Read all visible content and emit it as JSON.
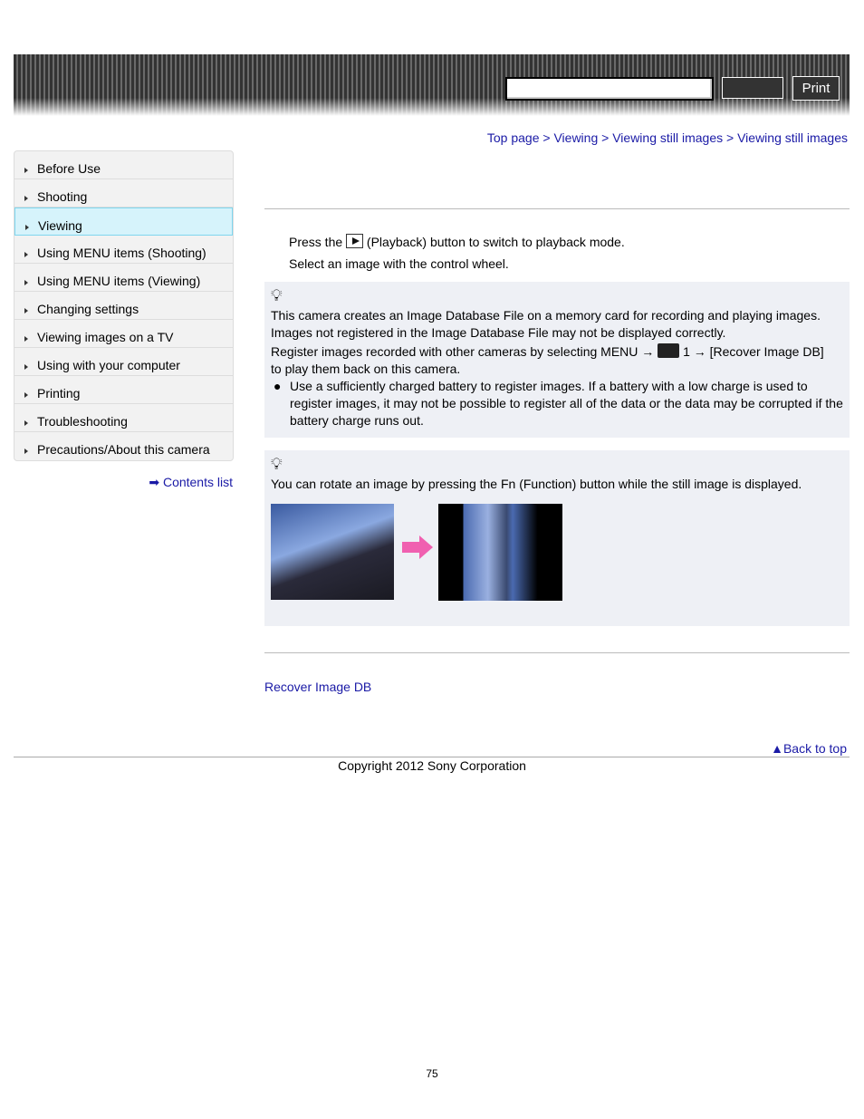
{
  "header": {
    "search_placeholder": "",
    "search_button": "",
    "print_label": "Print"
  },
  "breadcrumb": [
    "Top page",
    "Viewing",
    "Viewing still images",
    "Viewing still images"
  ],
  "sidebar": {
    "items": [
      "Before Use",
      "Shooting",
      "Viewing",
      "Using MENU items (Shooting)",
      "Using MENU items (Viewing)",
      "Changing settings",
      "Viewing images on a TV",
      "Using with your computer",
      "Printing",
      "Troubleshooting",
      "Precautions/About this camera"
    ],
    "selected": "Viewing",
    "contents_link": "Contents list"
  },
  "steps": {
    "s1_pre": "Press the",
    "s1_post": "(Playback) button to switch to playback mode.",
    "s2": "Select an image with the control wheel."
  },
  "hint1": {
    "l1": "This camera creates an Image Database File on a memory card for recording and playing images.",
    "l2": "Images not registered in the Image Database File may not be displayed correctly.",
    "l3_pre": "Register images recorded with other cameras by selecting MENU →",
    "l3_post": "1 → [Recover Image DB]",
    "l4": "to play them back on this camera.",
    "bullet": "Use a sufficiently charged battery to register images. If a battery with a low charge is used to register images, it may not be possible to register all of the data or the data may be corrupted if the battery charge runs out."
  },
  "hint2": {
    "text": "You can rotate an image by pressing the Fn (Function) button while the still image is displayed."
  },
  "related": "Recover Image DB",
  "back_to_top": "Back to top",
  "copyright": "Copyright 2012 Sony Corporation",
  "page_number": "75",
  "colors": {
    "link": "#1a1aa6",
    "selected": "#d6f3fb",
    "hint_bg": "#eef0f5",
    "arrow": "#f060b0"
  }
}
